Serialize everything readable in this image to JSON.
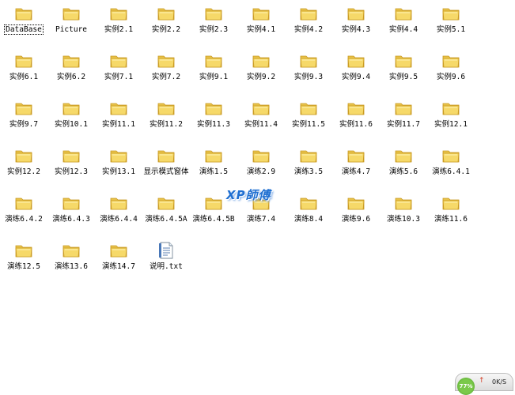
{
  "items": [
    {
      "label": "DataBase",
      "type": "folder",
      "selected": true
    },
    {
      "label": "Picture",
      "type": "folder"
    },
    {
      "label": "实例2.1",
      "type": "folder"
    },
    {
      "label": "实例2.2",
      "type": "folder"
    },
    {
      "label": "实例2.3",
      "type": "folder"
    },
    {
      "label": "实例4.1",
      "type": "folder"
    },
    {
      "label": "实例4.2",
      "type": "folder"
    },
    {
      "label": "实例4.3",
      "type": "folder"
    },
    {
      "label": "实例4.4",
      "type": "folder"
    },
    {
      "label": "实例5.1",
      "type": "folder"
    },
    {
      "label": "实例6.1",
      "type": "folder"
    },
    {
      "label": "实例6.2",
      "type": "folder"
    },
    {
      "label": "实例7.1",
      "type": "folder"
    },
    {
      "label": "实例7.2",
      "type": "folder"
    },
    {
      "label": "实例9.1",
      "type": "folder"
    },
    {
      "label": "实例9.2",
      "type": "folder"
    },
    {
      "label": "实例9.3",
      "type": "folder"
    },
    {
      "label": "实例9.4",
      "type": "folder"
    },
    {
      "label": "实例9.5",
      "type": "folder"
    },
    {
      "label": "实例9.6",
      "type": "folder"
    },
    {
      "label": "实例9.7",
      "type": "folder"
    },
    {
      "label": "实例10.1",
      "type": "folder"
    },
    {
      "label": "实例11.1",
      "type": "folder"
    },
    {
      "label": "实例11.2",
      "type": "folder"
    },
    {
      "label": "实例11.3",
      "type": "folder"
    },
    {
      "label": "实例11.4",
      "type": "folder"
    },
    {
      "label": "实例11.5",
      "type": "folder"
    },
    {
      "label": "实例11.6",
      "type": "folder"
    },
    {
      "label": "实例11.7",
      "type": "folder"
    },
    {
      "label": "实例12.1",
      "type": "folder"
    },
    {
      "label": "实例12.2",
      "type": "folder"
    },
    {
      "label": "实例12.3",
      "type": "folder"
    },
    {
      "label": "实例13.1",
      "type": "folder"
    },
    {
      "label": "显示模式窗体",
      "type": "folder"
    },
    {
      "label": "演练1.5",
      "type": "folder"
    },
    {
      "label": "演练2.9",
      "type": "folder"
    },
    {
      "label": "演练3.5",
      "type": "folder"
    },
    {
      "label": "演练4.7",
      "type": "folder"
    },
    {
      "label": "演练5.6",
      "type": "folder"
    },
    {
      "label": "演练6.4.1",
      "type": "folder"
    },
    {
      "label": "演练6.4.2",
      "type": "folder"
    },
    {
      "label": "演练6.4.3",
      "type": "folder"
    },
    {
      "label": "演练6.4.4",
      "type": "folder"
    },
    {
      "label": "演练6.4.5A",
      "type": "folder"
    },
    {
      "label": "演练6.4.5B",
      "type": "folder"
    },
    {
      "label": "演练7.4",
      "type": "folder"
    },
    {
      "label": "演练8.4",
      "type": "folder"
    },
    {
      "label": "演练9.6",
      "type": "folder"
    },
    {
      "label": "演练10.3",
      "type": "folder"
    },
    {
      "label": "演练11.6",
      "type": "folder"
    },
    {
      "label": "演练12.5",
      "type": "folder"
    },
    {
      "label": "演练13.6",
      "type": "folder"
    },
    {
      "label": "演练14.7",
      "type": "folder"
    },
    {
      "label": "说明.txt",
      "type": "file"
    }
  ],
  "watermark": "XP師傅",
  "network_widget": {
    "percent": "77%",
    "speed": "0K/S",
    "up_arrow": "↑"
  },
  "colors": {
    "folder_body": "#f6d969",
    "folder_tab": "#e8c24a",
    "folder_edge": "#c99a22",
    "selection_outline": "#000000",
    "watermark": "#1f6fd1"
  }
}
